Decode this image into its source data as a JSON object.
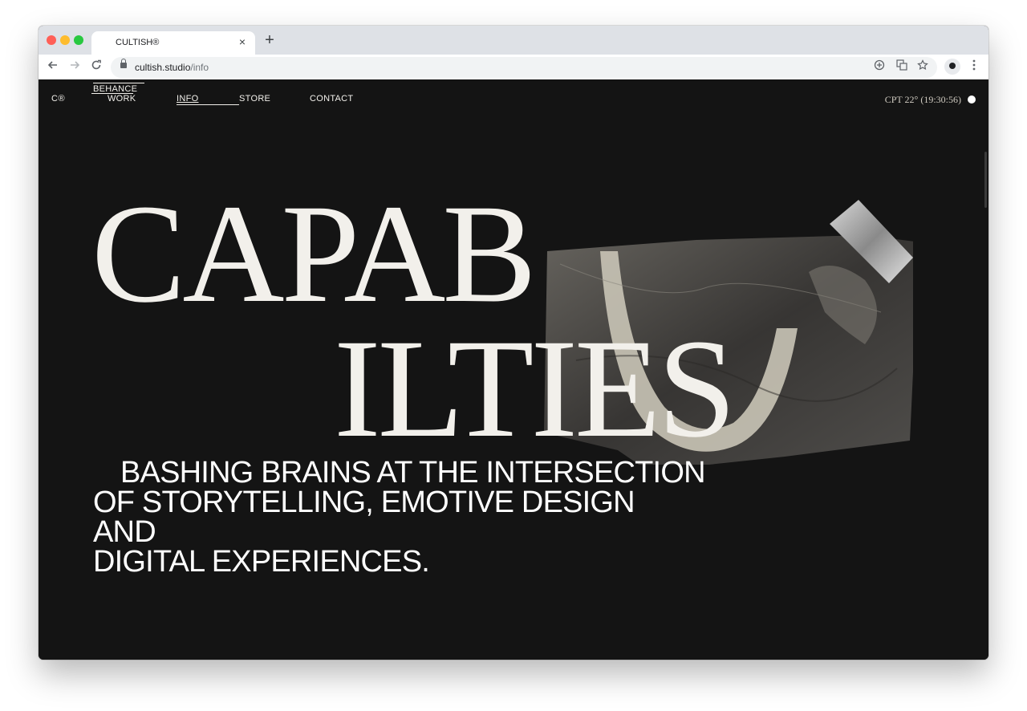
{
  "browser": {
    "tab_title": "CULTISH®",
    "tab_close": "×",
    "new_tab": "+",
    "url_host": "cultish.studio",
    "url_path": "/info"
  },
  "site": {
    "brand": "C®",
    "nav": {
      "behance": "BEHANCE",
      "work": "WORK",
      "info": "INFO",
      "store": "STORE",
      "contact": "CONTACT"
    },
    "clock": "CPT 22° (19:30:56)"
  },
  "hero": {
    "line1": "CAPAB",
    "line2": "ILTIES"
  },
  "tagline": [
    "BASHING BRAINS AT THE INTERSECTION",
    "OF STORYTELLING, EMOTIVE DESIGN",
    "AND",
    "DIGITAL EXPERIENCES."
  ],
  "icons": {
    "back": "arrow-left-icon",
    "forward": "arrow-right-icon",
    "reload": "reload-icon",
    "lock": "lock-icon",
    "add": "plus-circle-icon",
    "translate": "translate-icon",
    "star": "star-icon",
    "menu": "kebab-menu-icon"
  }
}
